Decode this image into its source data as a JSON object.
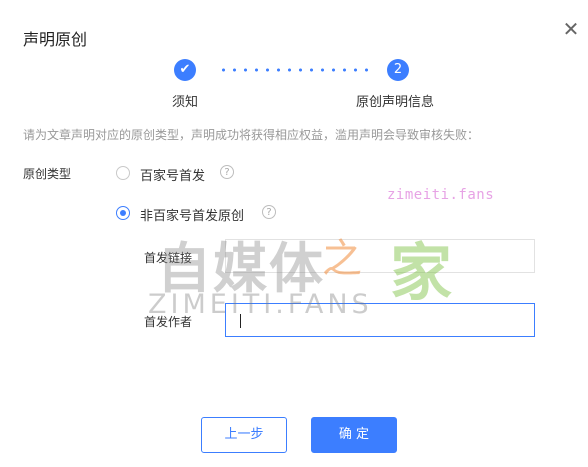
{
  "dialog": {
    "title": "声明原创",
    "close_icon": "close-icon"
  },
  "steps": [
    {
      "label": "须知",
      "state": "done",
      "icon": "check-icon"
    },
    {
      "label": "原创声明信息",
      "state": "active",
      "number": "2"
    }
  ],
  "tip": "请为文章声明对应的原创类型，声明成功将获得相应权益，滥用声明会导致审核失败：",
  "form": {
    "type_label": "原创类型",
    "options": [
      {
        "label": "百家号首发",
        "checked": false
      },
      {
        "label": "非百家号首发原创",
        "checked": true
      }
    ],
    "help_glyph": "?",
    "link_label": "首发链接",
    "link_value": "",
    "author_label": "首发作者",
    "author_value": ""
  },
  "buttons": {
    "prev": "上一步",
    "confirm": "确 定"
  },
  "watermark": {
    "small": "zimeiti.fans",
    "big_cn": "自媒体",
    "zhi": "之",
    "jia": "家",
    "big_en": "ZIMEITI.FANS"
  },
  "colors": {
    "accent": "#3c7eff"
  }
}
